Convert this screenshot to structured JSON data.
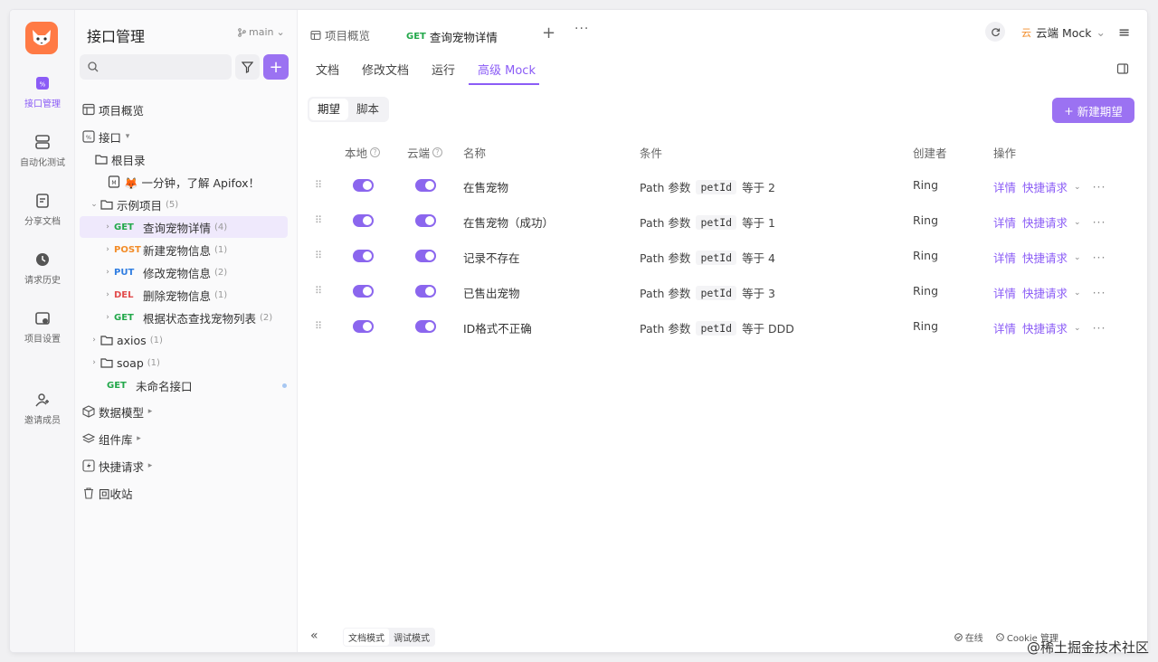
{
  "sidebar_rail": {
    "items": [
      {
        "label": "接口管理",
        "icon": "api-management-icon"
      },
      {
        "label": "自动化测试",
        "icon": "automation-icon"
      },
      {
        "label": "分享文档",
        "icon": "share-doc-icon"
      },
      {
        "label": "请求历史",
        "icon": "history-icon"
      },
      {
        "label": "项目设置",
        "icon": "settings-icon"
      },
      {
        "label": "邀请成员",
        "icon": "invite-icon"
      }
    ]
  },
  "tree_panel": {
    "title": "接口管理",
    "branch": "main",
    "overview": "项目概览",
    "interfaces": "接口",
    "root": "根目录",
    "intro_doc": "🦊 一分钟，了解 Apifox！",
    "folder_example": "示例项目",
    "folder_example_count": "(5)",
    "endpoints": [
      {
        "method": "GET",
        "name": "查询宠物详情",
        "count": "(4)"
      },
      {
        "method": "POST",
        "name": "新建宠物信息",
        "count": "(1)"
      },
      {
        "method": "PUT",
        "name": "修改宠物信息",
        "count": "(2)"
      },
      {
        "method": "DEL",
        "name": "删除宠物信息",
        "count": "(1)"
      },
      {
        "method": "GET",
        "name": "根据状态查找宠物列表",
        "count": "(2)"
      }
    ],
    "folder_axios": "axios",
    "folder_axios_count": "(1)",
    "folder_soap": "soap",
    "folder_soap_count": "(1)",
    "unnamed_method": "GET",
    "unnamed": "未命名接口",
    "data_models": "数据模型",
    "components": "组件库",
    "quick_request": "快捷请求",
    "recycle": "回收站"
  },
  "topbar": {
    "overview_tab": "项目概览",
    "active_tab_method": "GET",
    "active_tab": "查询宠物详情",
    "plus": "+",
    "more": "···",
    "cloud_tag": "云",
    "mock_select": "云端 Mock",
    "menu": "≡"
  },
  "subtabs": [
    "文档",
    "修改文档",
    "运行",
    "高级 Mock"
  ],
  "content": {
    "seg": [
      "期望",
      "脚本"
    ],
    "new_button": "新建期望",
    "headers": {
      "local": "本地",
      "cloud": "云端",
      "name": "名称",
      "condition": "条件",
      "creator": "创建者",
      "ops": "操作"
    },
    "rows": [
      {
        "name": "在售宠物",
        "cond_prefix": "Path 参数",
        "param": "petId",
        "cond_suffix": "等于 2",
        "creator": "Ring"
      },
      {
        "name": "在售宠物（成功）",
        "cond_prefix": "Path 参数",
        "param": "petId",
        "cond_suffix": "等于 1",
        "creator": "Ring"
      },
      {
        "name": "记录不存在",
        "cond_prefix": "Path 参数",
        "param": "petId",
        "cond_suffix": "等于 4",
        "creator": "Ring"
      },
      {
        "name": "已售出宠物",
        "cond_prefix": "Path 参数",
        "param": "petId",
        "cond_suffix": "等于 3",
        "creator": "Ring"
      },
      {
        "name": "ID格式不正确",
        "cond_prefix": "Path 参数",
        "param": "petId",
        "cond_suffix": "等于 DDD",
        "creator": "Ring"
      }
    ],
    "op_detail": "详情",
    "op_quick": "快捷请求"
  },
  "statusbar": {
    "mode_doc": "文档模式",
    "mode_debug": "调试模式",
    "online": "在线",
    "cookie": "Cookie 管理"
  },
  "watermark": "@稀土掘金技术社区",
  "colors": {
    "accent": "#8b5cf6",
    "button": "#9b72f2",
    "get": "#23a84b",
    "post": "#f28c28",
    "put": "#2f7de1",
    "del": "#e24c4c"
  }
}
